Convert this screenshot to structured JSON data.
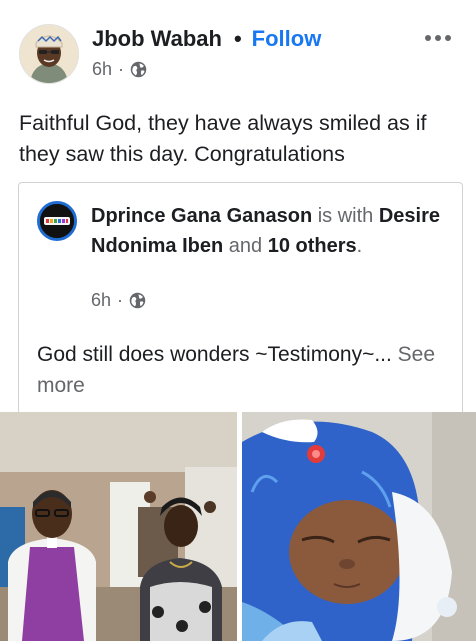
{
  "post": {
    "author": "Jbob Wabah",
    "separator": "•",
    "follow_label": "Follow",
    "time": "6h",
    "meta_separator": "·",
    "privacy_icon": "globe-icon",
    "more_icon": "more-options-icon",
    "text": "Faithful God, they have always smiled as if they saw this day. Congratulations"
  },
  "shared": {
    "author": "Dprince Gana Ganason",
    "is_with": " is with ",
    "tagged": "Desire Ndonima Iben",
    "and": " and ",
    "others": "10 others",
    "period": ".",
    "time": "6h",
    "meta_separator": "·",
    "privacy_icon": "globe-icon",
    "text": "God still does wonders ~Testimony~...",
    "see_more": " See more"
  },
  "colors": {
    "link_blue": "#1877f2",
    "secondary_text": "#65676b",
    "primary_text": "#1c1e21",
    "card_border": "#d0d2d6"
  }
}
